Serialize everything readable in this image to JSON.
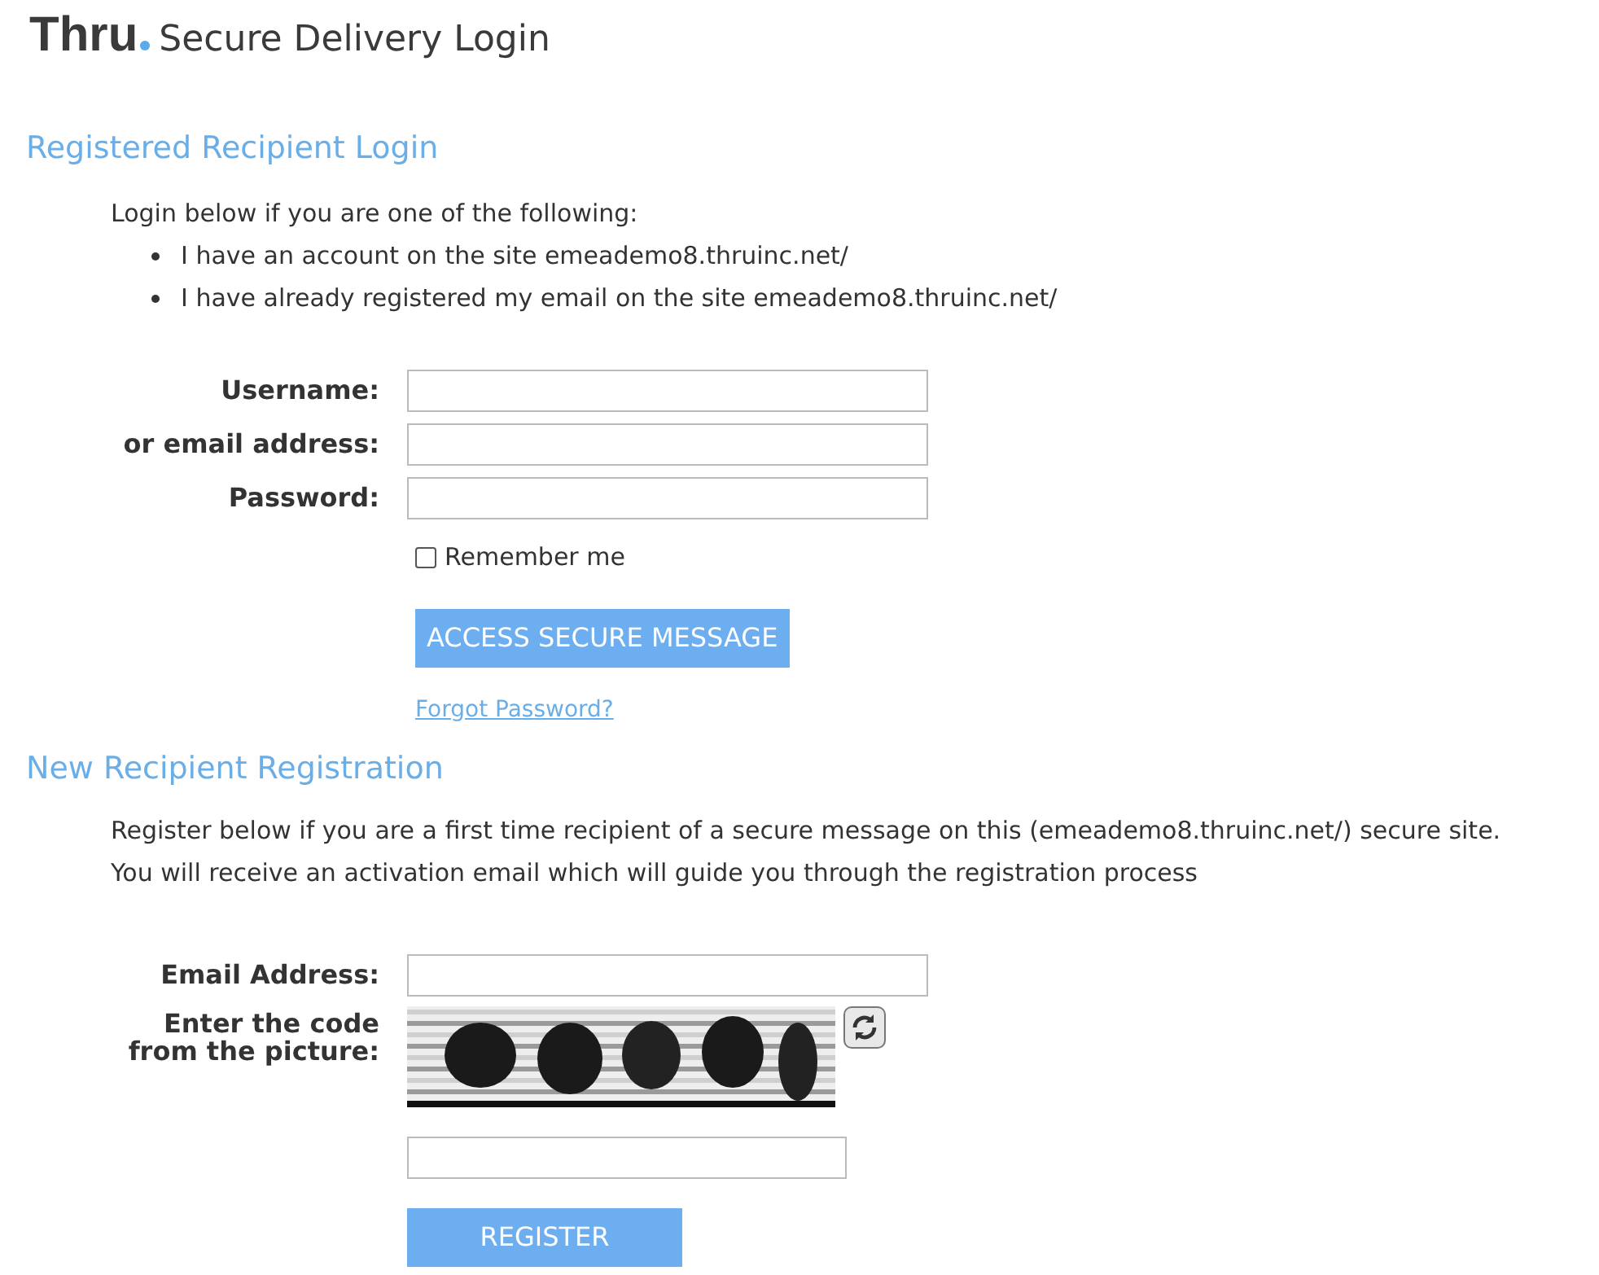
{
  "header": {
    "logo": "Thru",
    "title": "Secure Delivery Login"
  },
  "login_section": {
    "heading": "Registered Recipient Login",
    "intro": "Login below if you are one of the following:",
    "bullets": [
      "I have an account on the site emeademo8.thruinc.net/",
      "I have already registered my email on the site emeademo8.thruinc.net/"
    ],
    "fields": [
      {
        "label": "Username:"
      },
      {
        "label": "or email address:"
      },
      {
        "label": "Password:"
      }
    ],
    "remember": {
      "label": "Remember me",
      "checked": false
    },
    "button": "ACCESS SECURE MESSAGE",
    "link": "Forgot Password?"
  },
  "registration_section": {
    "heading": "New Recipient Registration",
    "lines": [
      "Register below if you are a first time recipient of a secure message on this (emeademo8.thruinc.net/) secure site.",
      "You will receive an activation email which will guide you through the registration process"
    ],
    "email_label": "Email Address:",
    "code_label_lines": [
      "Enter the code",
      "from the picture:"
    ],
    "captcha": {
      "kind": "picture"
    },
    "button": "REGISTER"
  }
}
